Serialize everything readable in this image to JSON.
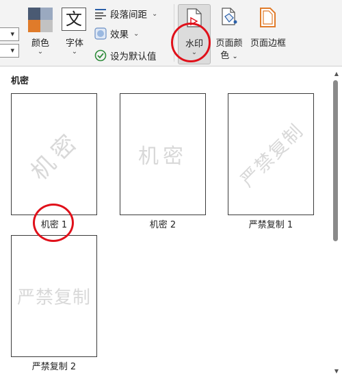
{
  "ribbon": {
    "colors": {
      "label": "颜色",
      "swatch": [
        "#4a5a73",
        "#9aa9c0",
        "#e07b2a",
        "#c2c2c2"
      ]
    },
    "fonts": {
      "glyph": "文",
      "label": "字体"
    },
    "paragraph_spacing": {
      "label": "段落间距"
    },
    "effects": {
      "label": "效果"
    },
    "set_default": {
      "label": "设为默认值"
    },
    "watermark": {
      "label": "水印",
      "highlighted": true
    },
    "page_color": {
      "label_line1": "页面颜",
      "label_line2": "色"
    },
    "page_borders": {
      "label": "页面边框"
    },
    "chevron": "⌄",
    "accent": "#e0101a"
  },
  "gallery": {
    "section_title": "机密",
    "items": [
      {
        "caption": "机密 1",
        "watermark": "机密",
        "style": "diagonal"
      },
      {
        "caption": "机密 2",
        "watermark": "机密",
        "style": "horizontal"
      },
      {
        "caption": "严禁复制 1",
        "watermark": "严禁复制",
        "style": "diagonal"
      },
      {
        "caption": "严禁复制 2",
        "watermark": "严禁复制",
        "style": "horizontal"
      }
    ]
  }
}
